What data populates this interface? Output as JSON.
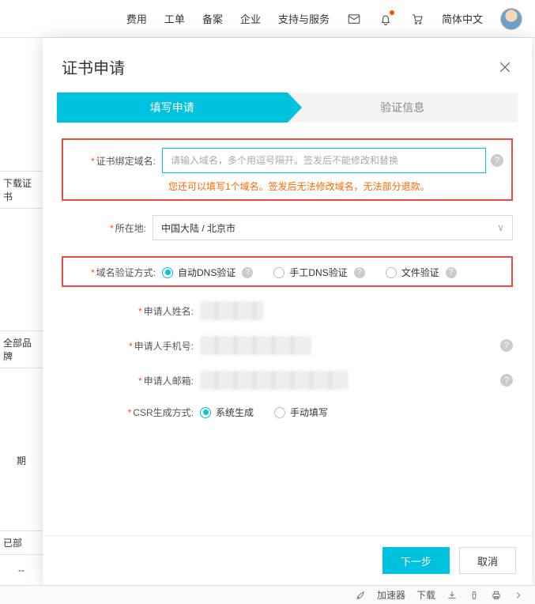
{
  "topnav": {
    "items": [
      "费用",
      "工单",
      "备案",
      "企业",
      "支持与服务"
    ],
    "lang": "简体中文"
  },
  "left": {
    "download_cert": "下载证书",
    "all_brand": "全部品牌",
    "period": "期",
    "deployed": "已部",
    "dash": "--"
  },
  "modal": {
    "title": "证书申请",
    "steps": {
      "fill": "填写申请",
      "verify": "验证信息"
    },
    "labels": {
      "domain": "证书绑定域名:",
      "warn": "您还可以填写1个域名。签发后无法修改域名，无法部分退款。",
      "region": "所在地:",
      "verify_method": "域名验证方式:",
      "applicant_name": "申请人姓名:",
      "applicant_phone": "申请人手机号:",
      "applicant_email": "申请人邮箱:",
      "csr": "CSR生成方式:"
    },
    "placeholders": {
      "domain": "请输入域名，多个用逗号隔开。签发后不能修改和替换"
    },
    "values": {
      "region": "中国大陆 / 北京市"
    },
    "verify_options": {
      "auto_dns": "自动DNS验证",
      "manual_dns": "手工DNS验证",
      "file": "文件验证"
    },
    "csr_options": {
      "system": "系统生成",
      "manual": "手动填写"
    },
    "buttons": {
      "next": "下一步",
      "cancel": "取消"
    }
  },
  "osbar": {
    "accel": "加速器",
    "download": "下载"
  },
  "colors": {
    "accent": "#00c1de",
    "warn": "#ff6a00",
    "highlight_border": "#e74c3c"
  }
}
